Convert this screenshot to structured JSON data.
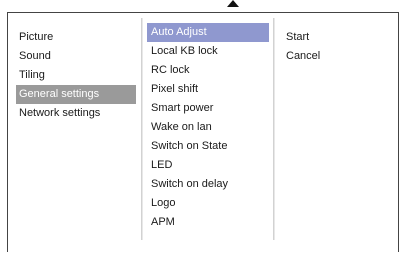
{
  "main_menu": {
    "items": [
      {
        "label": "Picture"
      },
      {
        "label": "Sound"
      },
      {
        "label": "Tiling"
      },
      {
        "label": "General settings"
      },
      {
        "label": "Network settings"
      }
    ],
    "selected_index": 3
  },
  "submenu": {
    "items": [
      {
        "label": "Auto Adjust"
      },
      {
        "label": "Local KB lock"
      },
      {
        "label": "RC lock"
      },
      {
        "label": "Pixel shift"
      },
      {
        "label": "Smart power"
      },
      {
        "label": "Wake on lan"
      },
      {
        "label": "Switch on State"
      },
      {
        "label": "LED"
      },
      {
        "label": "Switch on delay"
      },
      {
        "label": "Logo"
      },
      {
        "label": "APM"
      }
    ],
    "selected_index": 0
  },
  "options": {
    "items": [
      {
        "label": "Start"
      },
      {
        "label": "Cancel"
      }
    ]
  },
  "icons": {
    "scroll_up": "triangle-up-icon"
  },
  "colors": {
    "main_selected_bg": "#9a9a9a",
    "submenu_selected_bg": "#8f98cf"
  }
}
